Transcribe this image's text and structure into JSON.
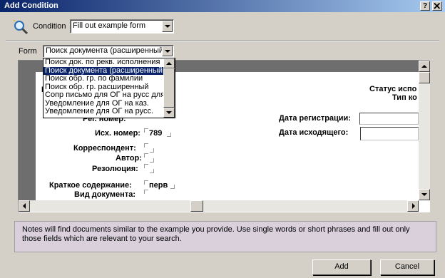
{
  "window": {
    "title": "Add Condition",
    "help_label": "?",
    "close_label": "x"
  },
  "condition": {
    "label": "Condition",
    "value": "Fill out example form"
  },
  "form": {
    "label": "Form",
    "value": "Поиск документа (расширенный",
    "options": [
      "Поиск док. по рекв. исполнения",
      "Поиск документа (расширенный",
      "Поиск обр. гр. по фамилии",
      "Поиск обр. гр. расширенный",
      "Сопр письмо для ОГ на русс для",
      "Уведомление для ОГ на каз.",
      "Уведомление для ОГ на русс."
    ],
    "selected_index": 1
  },
  "doc_form": {
    "left_labels": {
      "reg_number": "Рег. номер:",
      "out_number": "Исх. номер:",
      "correspondent": "Корреспондент:",
      "author": "Автор:",
      "resolution": "Резолюция:",
      "summary": "Краткое содержание:",
      "doc_type": "Вид документа:"
    },
    "out_number_value": "789",
    "summary_value": "перв",
    "right_labels": {
      "status": "Статус испо",
      "type": "Тип ко",
      "reg_date": "Дата регистрации:",
      "out_date": "Дата исходящего:"
    },
    "corner_letter": "I"
  },
  "note": "Notes will find documents similar to the example you provide.  Use single words or short phrases and fill out only those fields which are relevant to your search.",
  "buttons": {
    "add": "Add",
    "cancel": "Cancel"
  }
}
